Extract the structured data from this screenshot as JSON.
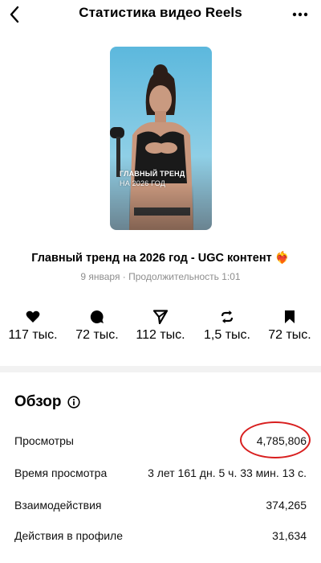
{
  "header": {
    "title": "Статистика видео Reels",
    "back_icon": "chevron-left-icon",
    "more_icon": "more-horizontal-icon"
  },
  "video": {
    "thumb_line1": "ГЛАВНЫЙ ТРЕНД",
    "thumb_line2": "НА 2026 ГОД",
    "title": "Главный тренд на 2026 год - UGC контент ❤️‍🔥",
    "meta": "9 января · Продолжительность 1:01"
  },
  "stats": [
    {
      "icon": "heart-icon",
      "value": "117 тыс."
    },
    {
      "icon": "comment-icon",
      "value": "72 тыс."
    },
    {
      "icon": "send-icon",
      "value": "112 тыс."
    },
    {
      "icon": "repost-icon",
      "value": "1,5 тыс."
    },
    {
      "icon": "bookmark-icon",
      "value": "72 тыс."
    }
  ],
  "overview": {
    "title": "Обзор",
    "rows": [
      {
        "label": "Просмотры",
        "value": "4,785,806"
      },
      {
        "label": "Время просмотра",
        "value": "3 лет 161 дн. 5 ч. 33 мин. 13 с."
      },
      {
        "label": "Взаимодействия",
        "value": "374,265"
      },
      {
        "label": "Действия в профиле",
        "value": "31,634"
      }
    ]
  },
  "colors": {
    "highlight_circle": "#d81e1e",
    "meta_gray": "#8e8e8e",
    "divider": "#f2f2f2"
  }
}
